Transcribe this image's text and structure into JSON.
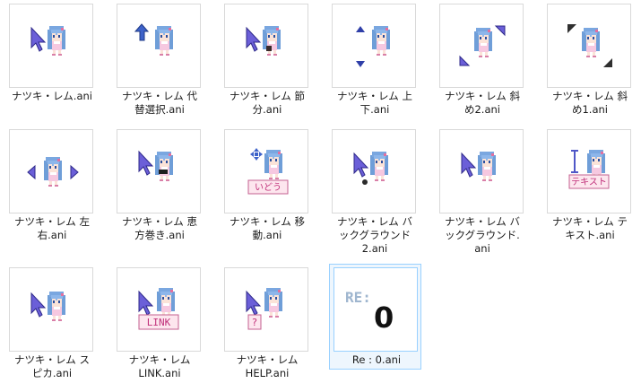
{
  "files": [
    {
      "name": "ナツキ・レム.ani"
    },
    {
      "name": "ナツキ・レム 代\n替選択.ani"
    },
    {
      "name": "ナツキ・レム 節\n分.ani"
    },
    {
      "name": "ナツキ・レム 上\n下.ani"
    },
    {
      "name": "ナツキ・レム 斜\nめ2.ani"
    },
    {
      "name": "ナツキ・レム 斜\nめ1.ani"
    },
    {
      "name": "ナツキ・レム 左\n右.ani"
    },
    {
      "name": "ナツキ・レム 恵\n方巻き.ani"
    },
    {
      "name": "ナツキ・レム 移\n動.ani"
    },
    {
      "name": "ナツキ・レム バ\nックグラウンド\n2.ani"
    },
    {
      "name": "ナツキ・レム バ\nックグラウンド.\nani"
    },
    {
      "name": "ナツキ・レム テ\nキスト.ani"
    },
    {
      "name": "ナツキ・レム ス\nピカ.ani"
    },
    {
      "name": "ナツキ・レム\nLINK.ani"
    },
    {
      "name": "ナツキ・レム\nHELP.ani"
    },
    {
      "name": "Re : 0.ani"
    }
  ],
  "badges": {
    "move": "いどう",
    "text": "テキスト",
    "link": "LINK",
    "help": "?",
    "re": "RE:",
    "zero": "0"
  },
  "icons": {
    "arrow": "arrow-cursor-icon",
    "character": "rem-character-icon"
  }
}
